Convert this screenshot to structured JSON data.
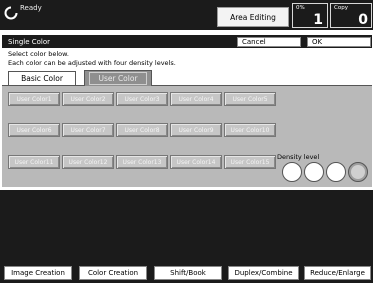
{
  "status": {
    "ready_icon": "ready-icon",
    "ready_label": "Ready",
    "area_editing_label": "Area Editing",
    "percent_label": "0%",
    "percent_value": "1",
    "copy_label": "Copy",
    "copy_value": "0"
  },
  "dialog": {
    "title": "Single Color",
    "cancel_label": "Cancel",
    "ok_label": "OK",
    "instruction_line1": "Select color below.",
    "instruction_line2": "Each color can be adjusted with four density levels.",
    "tabs": {
      "basic": "Basic Color",
      "user": "User Color"
    },
    "user_colors": [
      "User Color1",
      "User Color2",
      "User Color3",
      "User Color4",
      "User Color5",
      "User Color6",
      "User Color7",
      "User Color8",
      "User Color9",
      "User Color10",
      "User Color11",
      "User Color12",
      "User Color13",
      "User Color14",
      "User Color15"
    ],
    "density_label": "Density level",
    "density_levels": 4,
    "density_selected": 4
  },
  "function_keys": [
    "Image Creation",
    "Color Creation",
    "Shift/Book",
    "Duplex/Combine",
    "Reduce/Enlarge"
  ],
  "colors": {
    "bar": "#1b1b1b",
    "panel_gray": "#b9b9b9",
    "selected_tab": "#8f8f8f"
  }
}
